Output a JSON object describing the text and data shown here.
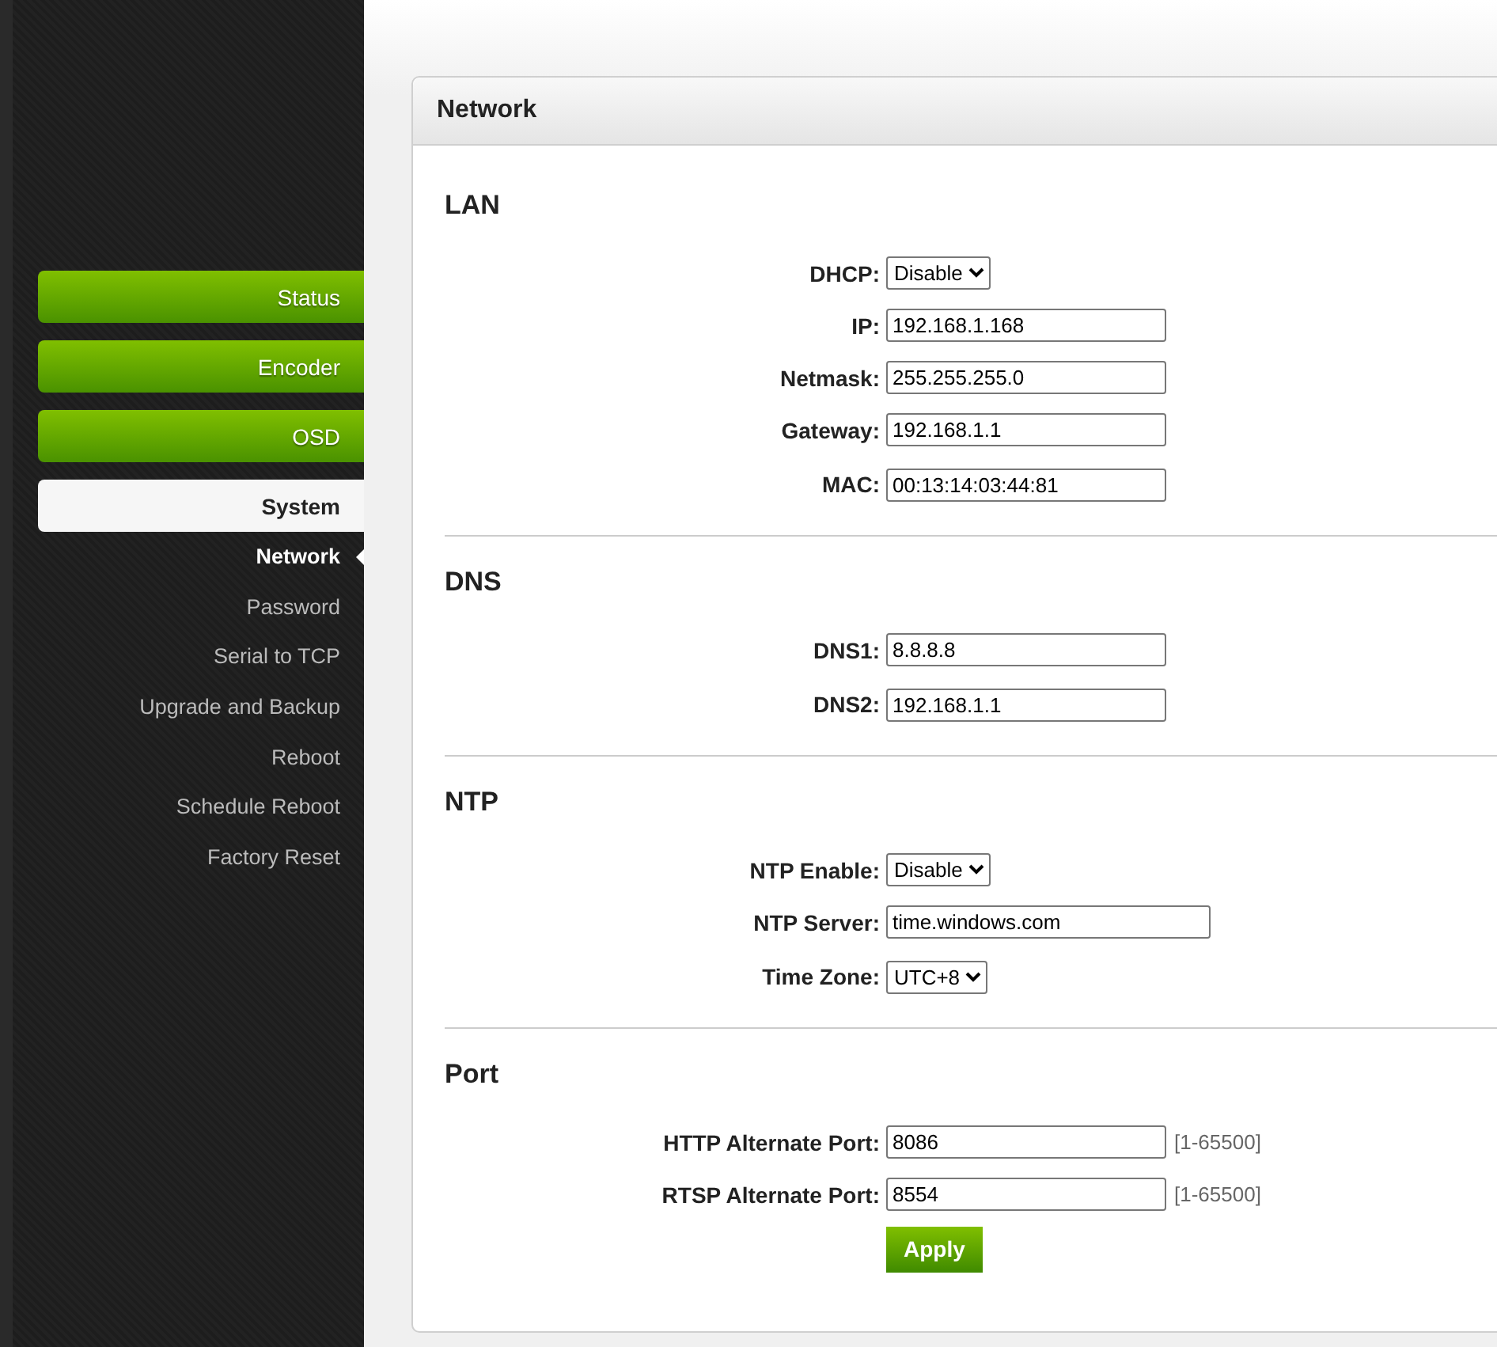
{
  "sidebar": {
    "menu": [
      {
        "label": "Status",
        "selected": false
      },
      {
        "label": "Encoder",
        "selected": false
      },
      {
        "label": "OSD",
        "selected": false
      },
      {
        "label": "System",
        "selected": true
      }
    ],
    "submenu": [
      {
        "label": "Network",
        "selected": true
      },
      {
        "label": "Password",
        "selected": false
      },
      {
        "label": "Serial to TCP",
        "selected": false
      },
      {
        "label": "Upgrade and Backup",
        "selected": false
      },
      {
        "label": "Reboot",
        "selected": false
      },
      {
        "label": "Schedule Reboot",
        "selected": false
      },
      {
        "label": "Factory Reset",
        "selected": false
      }
    ]
  },
  "panel": {
    "title": "Network",
    "sections": [
      {
        "title": "LAN",
        "fields": [
          {
            "label": "DHCP:",
            "kind": "select",
            "value": "Disable"
          },
          {
            "label": "IP:",
            "kind": "text",
            "value": "192.168.1.168"
          },
          {
            "label": "Netmask:",
            "kind": "text",
            "value": "255.255.255.0"
          },
          {
            "label": "Gateway:",
            "kind": "text",
            "value": "192.168.1.1"
          },
          {
            "label": "MAC:",
            "kind": "text",
            "value": "00:13:14:03:44:81"
          }
        ]
      },
      {
        "title": "DNS",
        "fields": [
          {
            "label": "DNS1:",
            "kind": "text",
            "value": "8.8.8.8"
          },
          {
            "label": "DNS2:",
            "kind": "text",
            "value": "192.168.1.1"
          }
        ]
      },
      {
        "title": "NTP",
        "fields": [
          {
            "label": "NTP Enable:",
            "kind": "select",
            "value": "Disable"
          },
          {
            "label": "NTP Server:",
            "kind": "wide",
            "value": "time.windows.com"
          },
          {
            "label": "Time Zone:",
            "kind": "select",
            "value": "UTC+8"
          }
        ]
      },
      {
        "title": "Port",
        "fields": [
          {
            "label": "HTTP Alternate Port:",
            "kind": "text",
            "value": "8086",
            "hint": "[1-65500]"
          },
          {
            "label": "RTSP Alternate Port:",
            "kind": "text",
            "value": "8554",
            "hint": "[1-65500]"
          }
        ]
      }
    ],
    "apply": "Apply"
  }
}
